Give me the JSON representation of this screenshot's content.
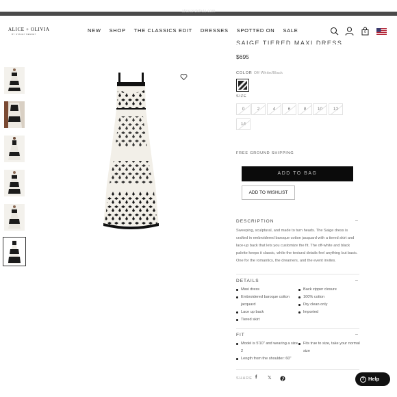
{
  "browser": {
    "url": "aliceandolivia.com"
  },
  "brand": {
    "logo": "ALICE + OLIVIA",
    "logo_sub": "BY STACEY BENDET"
  },
  "nav": [
    "NEW",
    "SHOP",
    "THE CLASSICS EDIT",
    "DRESSES",
    "SPOTTED ON",
    "SALE"
  ],
  "header_icons": [
    "search-icon",
    "account-icon",
    "cart-icon",
    "flag-icon"
  ],
  "cart": {
    "count": "0"
  },
  "product": {
    "title": "SAIGE TIERED MAXI DRESS",
    "price": "$695",
    "color_label": "COLOR",
    "color_value": "Off White/Black",
    "size_label": "SIZE",
    "sizes": [
      "0",
      "2",
      "4",
      "6",
      "8",
      "10",
      "12",
      "14"
    ],
    "shipping": "FREE GROUND SHIPPING",
    "add_to_bag": "ADD TO BAG",
    "add_to_wishlist": "ADD TO WISHLIST"
  },
  "description": {
    "heading": "DESCRIPTION",
    "text": "Sweeping, sculptural, and made to turn heads. The Saige dress is crafted in embroidered baroque cotton jacquard with a tiered skirt and lace-up back that lets you customize the fit. The off-white and black palette keeps it classic, while the textural details feel anything but basic. One for the romantics, the dreamers, and the event invites."
  },
  "details": {
    "heading": "DETAILS",
    "left": [
      "Maxi dress",
      "Embroidered baroque cotton jacquard",
      "Lace up back",
      "Tiered skirt"
    ],
    "right": [
      "Back zipper closure",
      "100% cotton",
      "Dry clean only",
      "Imported"
    ]
  },
  "fit": {
    "heading": "FIT",
    "left": [
      "Model is 5'10\" and wearing a size 2",
      "Length from the shoulder: 60\""
    ],
    "right": [
      "Fits true to size, take your normal size"
    ]
  },
  "share": {
    "label": "SHARE",
    "icons": [
      "facebook-icon",
      "x-icon",
      "pinterest-icon"
    ]
  },
  "help": {
    "label": "Help"
  },
  "colors": {
    "black": "#0b0b0b",
    "ivory": "#f3f1ec",
    "flag_red": "#b22234",
    "flag_blue": "#3c3b6e"
  }
}
